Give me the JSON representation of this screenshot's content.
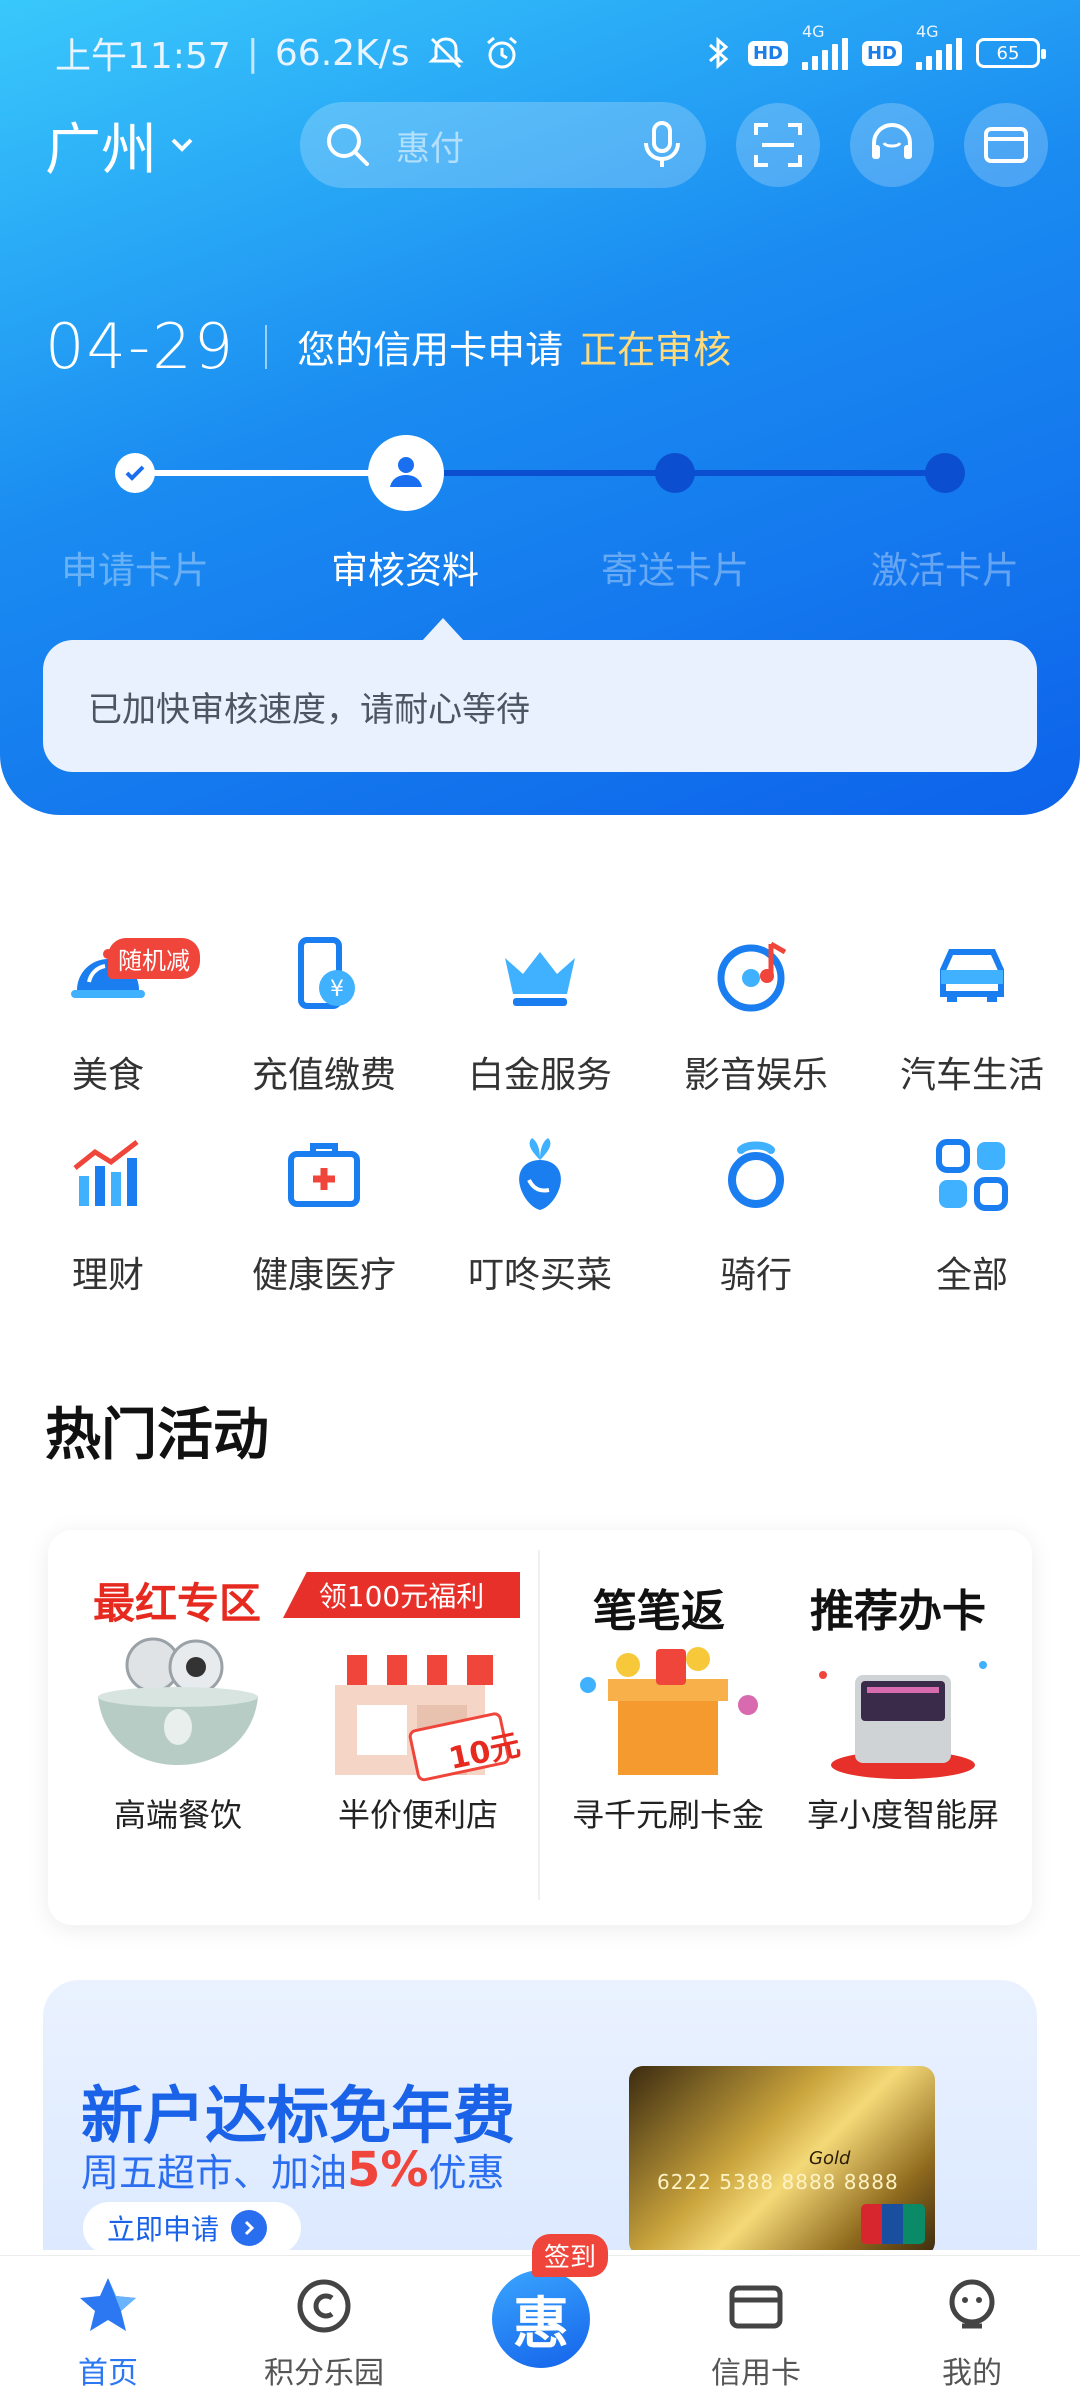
{
  "status_bar": {
    "time": "上午11:57",
    "speed": "66.2K/s",
    "hd1": "HD",
    "hd2": "HD",
    "net1": "4G",
    "net2": "4G",
    "battery": "65"
  },
  "top_bar": {
    "city": "广州",
    "search_placeholder": "惠付"
  },
  "application": {
    "date": "04-29",
    "text": "您的信用卡申请",
    "status": "正在审核",
    "steps": [
      "申请卡片",
      "审核资料",
      "寄送卡片",
      "激活卡片"
    ],
    "current_step": 2,
    "notice": "已加快审核速度，请耐心等待"
  },
  "services": [
    {
      "label": "美食",
      "icon": "food-cloche-icon",
      "badge": "随机减"
    },
    {
      "label": "充值缴费",
      "icon": "phone-payment-icon"
    },
    {
      "label": "白金服务",
      "icon": "crown-icon"
    },
    {
      "label": "影音娱乐",
      "icon": "music-disc-icon"
    },
    {
      "label": "汽车生活",
      "icon": "car-icon"
    },
    {
      "label": "理财",
      "icon": "bar-chart-icon"
    },
    {
      "label": "健康医疗",
      "icon": "medical-kit-icon"
    },
    {
      "label": "叮咚买菜",
      "icon": "vegetable-icon"
    },
    {
      "label": "骑行",
      "icon": "bike-icon"
    },
    {
      "label": "全部",
      "icon": "grid-icon"
    }
  ],
  "hot": {
    "title": "热门活动",
    "zone_title": "最红专区",
    "zone_tag": "领100元福利",
    "items": [
      {
        "label": "高端餐饮"
      },
      {
        "label": "半价便利店",
        "coupon": "10元"
      },
      {
        "label": "寻千元刷卡金",
        "header": "笔笔返"
      },
      {
        "label": "享小度智能屏",
        "header": "推荐办卡"
      }
    ]
  },
  "promo": {
    "title": "新户达标免年费",
    "subtitle_pre": "周五超市、加油",
    "subtitle_hl": "5%",
    "subtitle_post": "优惠",
    "button": "立即申请",
    "card_text": "Gold",
    "card_number": "6222 5388 8888 8888"
  },
  "nav": {
    "items": [
      "首页",
      "积分乐园",
      "",
      "信用卡",
      "我的"
    ],
    "center_badge": "签到",
    "center_glyph": "惠"
  },
  "colors": {
    "primary": "#1a7ef0",
    "accent_red": "#f0453a",
    "status_yellow": "#ffd97a"
  }
}
